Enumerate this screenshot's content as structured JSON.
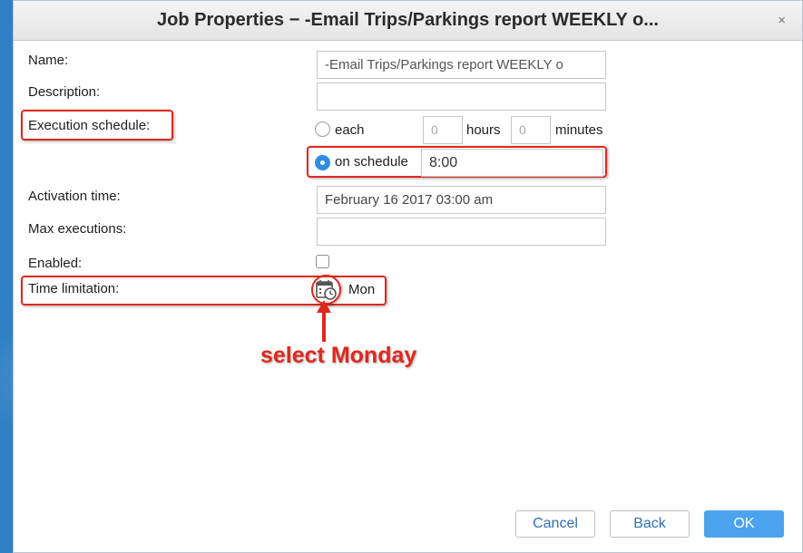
{
  "dialog": {
    "title": "Job Properties − -Email Trips/Parkings report WEEKLY o...",
    "close_glyph": "×"
  },
  "form": {
    "name_label": "Name:",
    "name_value": "-Email Trips/Parkings report WEEKLY o",
    "description_label": "Description:",
    "description_value": "",
    "execution_schedule_label": "Execution schedule:",
    "each_label": "each",
    "hours_placeholder": "0",
    "hours_label": "hours",
    "minutes_placeholder": "0",
    "minutes_label": "minutes",
    "on_schedule_label": "on schedule",
    "schedule_time_value": "8:00",
    "selected_mode": "on schedule",
    "activation_time_label": "Activation time:",
    "activation_time_value": "February 16 2017 03:00 am",
    "max_executions_label": "Max executions:",
    "max_executions_value": "",
    "enabled_label": "Enabled:",
    "enabled_checked": false,
    "time_limitation_label": "Time limitation:",
    "time_limitation_icon": "calendar-clock-icon",
    "time_limitation_value": "Mon"
  },
  "annotation": {
    "text": "select Monday",
    "color": "#e0281e"
  },
  "buttons": {
    "cancel": "Cancel",
    "back": "Back",
    "ok": "OK"
  },
  "colors": {
    "accent": "#4aa3ec",
    "radio_selected": "#2f8de4",
    "highlight": "#e0281e",
    "background": "#2f7fc4"
  }
}
